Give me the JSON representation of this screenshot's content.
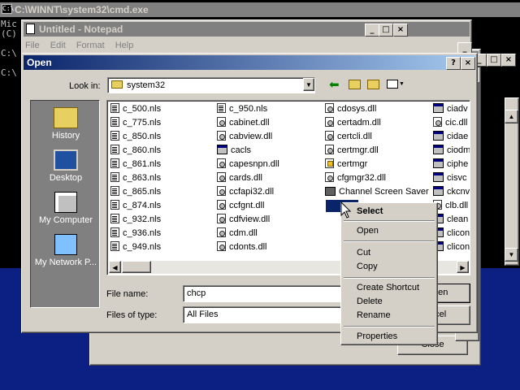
{
  "cmd": {
    "title": "C:\\WINNT\\system32\\cmd.exe",
    "lines": [
      "Mic",
      "(C)",
      "C:\\",
      "C:\\"
    ]
  },
  "notepad": {
    "title": "Untitled - Notepad",
    "menu": [
      "File",
      "Edit",
      "Format",
      "Help"
    ]
  },
  "back_dialog": {
    "close_label": "Close"
  },
  "open_dialog": {
    "title": "Open",
    "help_glyph": "?",
    "close_glyph": "×",
    "look_in_label": "Look in:",
    "look_in_value": "system32",
    "places": [
      {
        "label": "History",
        "icon": "history-icon"
      },
      {
        "label": "Desktop",
        "icon": "desktop-icon"
      },
      {
        "label": "My Computer",
        "icon": "my-computer-icon"
      },
      {
        "label": "My Network P...",
        "icon": "network-places-icon"
      }
    ],
    "files": [
      [
        "c_500.nls",
        "c_775.nls",
        "c_850.nls",
        "c_860.nls",
        "c_861.nls",
        "c_863.nls",
        "c_865.nls",
        "c_874.nls",
        "c_932.nls",
        "c_936.nls",
        "c_949.nls"
      ],
      [
        "c_950.nls",
        "cabinet.dll",
        "cabview.dll",
        "cacls",
        "capesnpn.dll",
        "cards.dll",
        "ccfapi32.dll",
        "ccfgnt.dll",
        "cdfview.dll",
        "cdm.dll",
        "cdonts.dll"
      ],
      [
        "cdosys.dll",
        "certadm.dll",
        "certcli.dll",
        "certmgr.dll",
        "certmgr",
        "cfgmgr32.dll",
        "Channel Screen Saver",
        "",
        "",
        "",
        ""
      ],
      [
        "ciadv",
        "cic.dll",
        "cidae",
        "ciodm",
        "ciphe",
        "cisvc",
        "ckcnv",
        "clb.dll",
        "clean",
        "clicon",
        "clicon"
      ]
    ],
    "file_name_label": "File name:",
    "file_name_value": "chcp",
    "files_of_type_label": "Files of type:",
    "files_of_type_value": "All Files",
    "open_button_partial": "pen",
    "cancel_button_partial": "ncel"
  },
  "context_menu": {
    "items": [
      "Select",
      "Open",
      "Cut",
      "Copy",
      "Create Shortcut",
      "Delete",
      "Rename",
      "Properties"
    ]
  },
  "colors": {
    "desktop": "#0c1f82",
    "titlebar_active": "#0a246a",
    "titlebar_active_end": "#a6caf0",
    "titlebar_inactive": "#808080",
    "face": "#d4d0c8"
  }
}
